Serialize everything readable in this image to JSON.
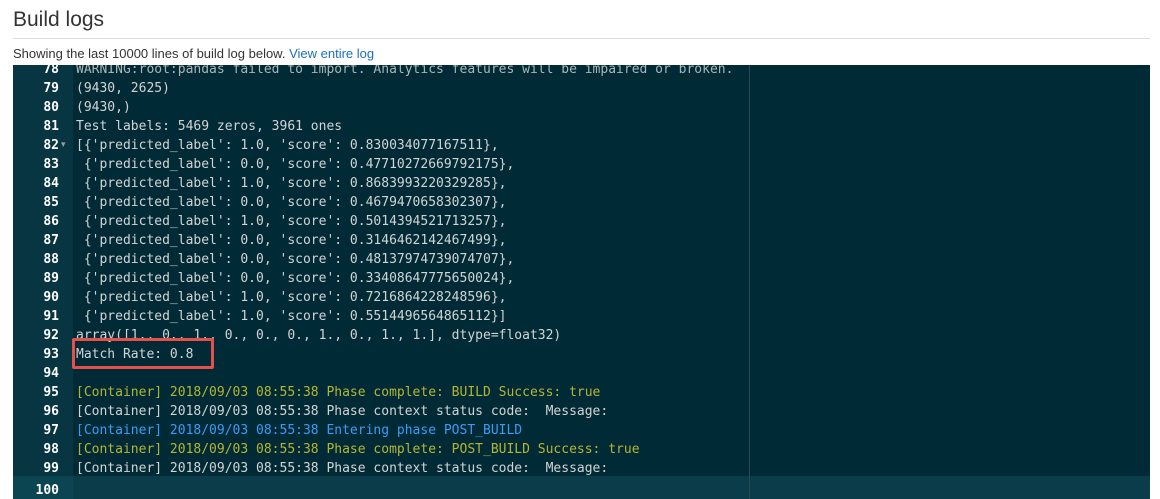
{
  "header": {
    "title": "Build logs",
    "subtitle_text": "Showing the last 10000 lines of build log below.",
    "view_link": "View entire log"
  },
  "colors": {
    "log_background": "#002b36",
    "gutter_background": "#073642",
    "phase_text": "#b5b532",
    "entering_phase_text": "#3d9bf5",
    "highlight_border": "#e5504a",
    "link": "#1a6fc2"
  },
  "log": {
    "lines": [
      {
        "num": "78",
        "text": "WARNING:root:pandas failed to import. Analytics features will be impaired or broken.",
        "style": "gray",
        "fold": ""
      },
      {
        "num": "79",
        "text": "(9430, 2625)",
        "style": "gray",
        "fold": ""
      },
      {
        "num": "80",
        "text": "(9430,)",
        "style": "gray",
        "fold": ""
      },
      {
        "num": "81",
        "text": "Test labels: 5469 zeros, 3961 ones",
        "style": "gray",
        "fold": ""
      },
      {
        "num": "82",
        "text": "[{'predicted_label': 1.0, 'score': 0.830034077167511},",
        "style": "gray",
        "fold": "▾"
      },
      {
        "num": "83",
        "text": " {'predicted_label': 0.0, 'score': 0.47710272669792175},",
        "style": "gray",
        "fold": ""
      },
      {
        "num": "84",
        "text": " {'predicted_label': 1.0, 'score': 0.8683993220329285},",
        "style": "gray",
        "fold": ""
      },
      {
        "num": "85",
        "text": " {'predicted_label': 0.0, 'score': 0.4679470658302307},",
        "style": "gray",
        "fold": ""
      },
      {
        "num": "86",
        "text": " {'predicted_label': 1.0, 'score': 0.5014394521713257},",
        "style": "gray",
        "fold": ""
      },
      {
        "num": "87",
        "text": " {'predicted_label': 0.0, 'score': 0.3146462142467499},",
        "style": "gray",
        "fold": ""
      },
      {
        "num": "88",
        "text": " {'predicted_label': 0.0, 'score': 0.48137974739074707},",
        "style": "gray",
        "fold": ""
      },
      {
        "num": "89",
        "text": " {'predicted_label': 0.0, 'score': 0.33408647775650024},",
        "style": "gray",
        "fold": ""
      },
      {
        "num": "90",
        "text": " {'predicted_label': 1.0, 'score': 0.7216864228248596},",
        "style": "gray",
        "fold": ""
      },
      {
        "num": "91",
        "text": " {'predicted_label': 1.0, 'score': 0.5514496564865112}]",
        "style": "gray",
        "fold": ""
      },
      {
        "num": "92",
        "text": "array([1., 0., 1., 0., 0., 0., 1., 0., 1., 1.], dtype=float32)",
        "style": "gray",
        "fold": ""
      },
      {
        "num": "93",
        "text": "Match Rate: 0.8",
        "style": "gray",
        "fold": ""
      },
      {
        "num": "94",
        "text": "",
        "style": "gray",
        "fold": ""
      },
      {
        "num": "95",
        "text": "[Container] 2018/09/03 08:55:38 Phase complete: BUILD Success: true",
        "style": "olive",
        "fold": ""
      },
      {
        "num": "96",
        "text": "[Container] 2018/09/03 08:55:38 Phase context status code:  Message:",
        "style": "gray",
        "fold": ""
      },
      {
        "num": "97",
        "text": "[Container] 2018/09/03 08:55:38 Entering phase POST_BUILD",
        "style": "blue",
        "fold": ""
      },
      {
        "num": "98",
        "text": "[Container] 2018/09/03 08:55:38 Phase complete: POST_BUILD Success: true",
        "style": "olive",
        "fold": ""
      },
      {
        "num": "99",
        "text": "[Container] 2018/09/03 08:55:38 Phase context status code:  Message:",
        "style": "gray",
        "fold": ""
      },
      {
        "num": "100",
        "text": "",
        "style": "gray",
        "fold": ""
      }
    ]
  }
}
